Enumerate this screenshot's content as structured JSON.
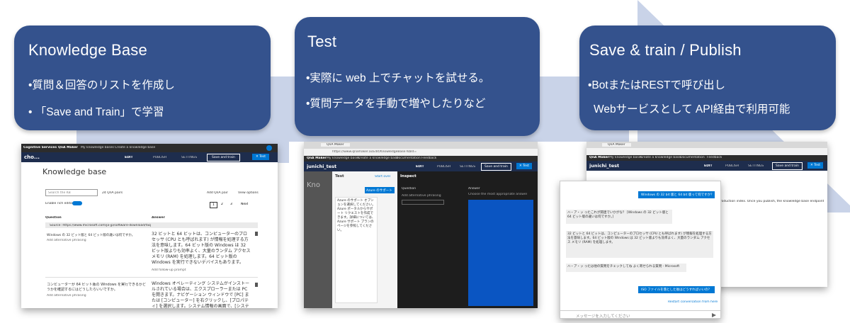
{
  "cards": [
    {
      "title": "Knowledge Base",
      "bullets": [
        "•質問＆回答のリストを作成し",
        "• 「Save and Train」で学習"
      ]
    },
    {
      "title": "Test",
      "bullets": [
        "•実際に web 上でチャットを試せる。",
        "•質問データを手動で増やしたりなど"
      ]
    },
    {
      "title": "Save & train / Publish",
      "bullets": [
        "•BotまたはRESTで呼び出し",
        "Webサービスとして API経由で利用可能"
      ]
    }
  ],
  "shot1": {
    "topbar": [
      "Cognitive Services",
      "QnA Maker",
      "My knowledge bases",
      "Create a knowledge base"
    ],
    "kb_short": "cho...",
    "tabs": [
      "EDIT",
      "PUBLISH",
      "SETTINGS"
    ],
    "save_train": "Save and train",
    "test": "✕ Test",
    "heading": "Knowledge base",
    "search_placeholder": "Search the KB",
    "qna_pairs": "24 QnA pairs",
    "add_pair": "Add QnA pair",
    "view_options": "View options",
    "rich_editor": "Enable rich editor",
    "pages": [
      "1",
      "2",
      "3",
      "Next"
    ],
    "col_question": "Question",
    "col_answer": "Answer",
    "source": "Source: https://www.microsoft.com/ja-jp/software-download/faq",
    "q1": "Windows の 32 ビット版と 64 ビット版の違いは何ですか。",
    "alt1": "Add alternative phrasing",
    "a1": "32 ビットと 64 ビットは、コンピューターのプロセッサ (CPU とも呼ばれます) が情報を処理する方法を意味します。64 ビット版の Windows は 32 ビット版よりも効率よく、大量のランダム アクセス メモリ (RAM) を処理します。64 ビット版の Windows を実行できないデバイスもあります。",
    "follow": "Add follow-up prompt",
    "q2": "コンピューターが 64 ビット版の Windows を実行できるかどうかを確認するにはどうしたらいいですか。",
    "alt2": "Add alternative phrasing",
    "a2": "Windows オペレーティング システムがインストールされている場合は、エクスプローラーまたは PC を開きます。ナビゲーション ウィンドウで [PC] または [コンピューター] を右クリックし、[プロパティ] を選択します。システム情報の画面で、[システムの種類] の情報を確認"
  },
  "shot2": {
    "tab": "QnA Maker",
    "url": "https://www.qnamaker.ai/Edit/KnowledgeBase?kbId=",
    "nav": [
      "QnA Maker",
      "My knowledge bases",
      "Create a knowledge base",
      "Documentation",
      "Feedback"
    ],
    "kb": "junichi_test",
    "tabs": [
      "EDIT",
      "PUBLISH",
      "SETTINGS"
    ],
    "save_train": "Save and train",
    "test": "✕ Test",
    "test_title": "Test",
    "start_over": "Start over",
    "inspect_title": "Inspect",
    "question_label": "Question",
    "add_alt": "Add alternative phrasing",
    "answer_label": "Answer",
    "choose_answer": "Choose the most appropriate answer",
    "user_msg": "Azure のサポート",
    "bot_msg": "Azure のサポート オプションを選択してください。Azure ポータルからサポート リクエストを作成できます。詳細については、Azure サポート プランのページを参照してください。",
    "heading_partial": "Kno"
  },
  "shot3": {
    "tab": "QnA Maker",
    "nav": [
      "QnA Maker",
      "My knowledge bases",
      "Create a knowledge base",
      "Documentation",
      "Feedback"
    ],
    "kb": "junichi_test",
    "tabs": [
      "EDIT",
      "PUBLISH",
      "SETTINGS"
    ],
    "save_train": "Save and train",
    "test": "✕ Test",
    "publish_text": "production index. Once you publish, the knowledge base endpoint",
    "chat": {
      "user1": "Windows の 32 bit 版と 64 bit 版って何ですか？",
      "bot1": "ハ・ア・ッ ったこれが関連でいかがな？ [Windows の 32 ビット版と 64 ビット版の違いは何ですか。]",
      "bot2": "32 ビットと 64 ビットは、コンピューターのプロセッサ (CPU とも呼ばれます) が情報を処理する方法を意味します。64 ビット版の Windows は 32 ビット版よりも効率よく、大量のランダム アクセス メモリ (RAM) を処理します。",
      "bot3": "ハ・ア・ッ ったは他の質問をチェックしてね よく寄せられる質問 - Microsoft",
      "user2": "ISO ファイルを落とした後はどうすればいいの？",
      "restart": "Restart conversation from here",
      "input_placeholder": "メッセージを入力してください"
    }
  }
}
